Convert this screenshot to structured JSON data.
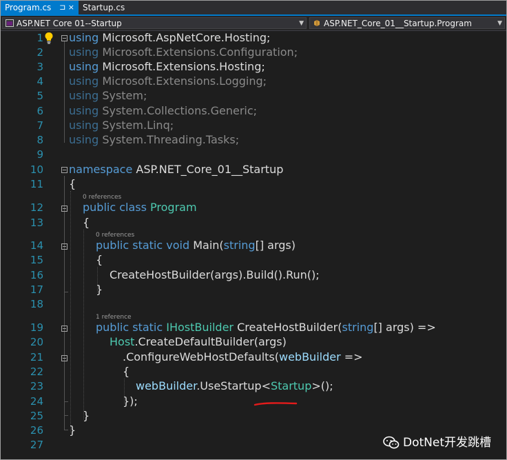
{
  "tabs": [
    {
      "label": "Program.cs",
      "active": true,
      "actions": "⊐ ×"
    },
    {
      "label": "Startup.cs",
      "active": false
    }
  ],
  "nav": {
    "project": "ASP.NET Core 01--Startup",
    "class": "ASP.NET_Core_01__Startup.Program"
  },
  "line_numbers": [
    "1",
    "2",
    "3",
    "4",
    "5",
    "6",
    "7",
    "8",
    "9",
    "10",
    "11",
    "12",
    "13",
    "14",
    "15",
    "16",
    "17",
    "18",
    "19",
    "20",
    "21",
    "22",
    "23",
    "24",
    "25",
    "26",
    "27"
  ],
  "codelens": {
    "class_refs": "0 references",
    "main_refs": "0 references",
    "builder_refs": "1 reference"
  },
  "code": {
    "using": "using",
    "ns1": "Microsoft.AspNetCore.Hosting;",
    "ns2": "Microsoft.Extensions.Configuration;",
    "ns3": "Microsoft.Extensions.Hosting;",
    "ns4": "Microsoft.Extensions.Logging;",
    "ns5": "System;",
    "ns6": "System.Collections.Generic;",
    "ns7": "System.Linq;",
    "ns8": "System.Threading.Tasks;",
    "namespace_kw": "namespace",
    "namespace_name": "ASP.NET_Core_01__Startup",
    "open_brace": "{",
    "close_brace": "}",
    "class_kw": "public class",
    "class_name": "Program",
    "main_kw": "public static void",
    "main_name": "Main(",
    "string_kw": "string",
    "main_params": "[] args)",
    "main_body": "CreateHostBuilder(args).Build().Run();",
    "builder_kw": "public static",
    "builder_type": "IHostBuilder",
    "builder_name": "CreateHostBuilder(",
    "builder_params": "[] args) =>",
    "host_type": "Host",
    "host_call": ".CreateDefaultBuilder(args)",
    "configure_call": ".ConfigureWebHostDefaults(",
    "web_builder": "webBuilder",
    "lambda": "=>",
    "use_startup_pre": ".UseStartup<",
    "use_startup_type": "Startup",
    "use_startup_post": ">();",
    "lambda_close": "});"
  },
  "watermark": "DotNet开发跳槽",
  "colors": {
    "keyword": "#569cd6",
    "type": "#4ec9b0",
    "line_number": "#2b91af",
    "annotation": "#e31b1b",
    "tab_active": "#007acc"
  }
}
